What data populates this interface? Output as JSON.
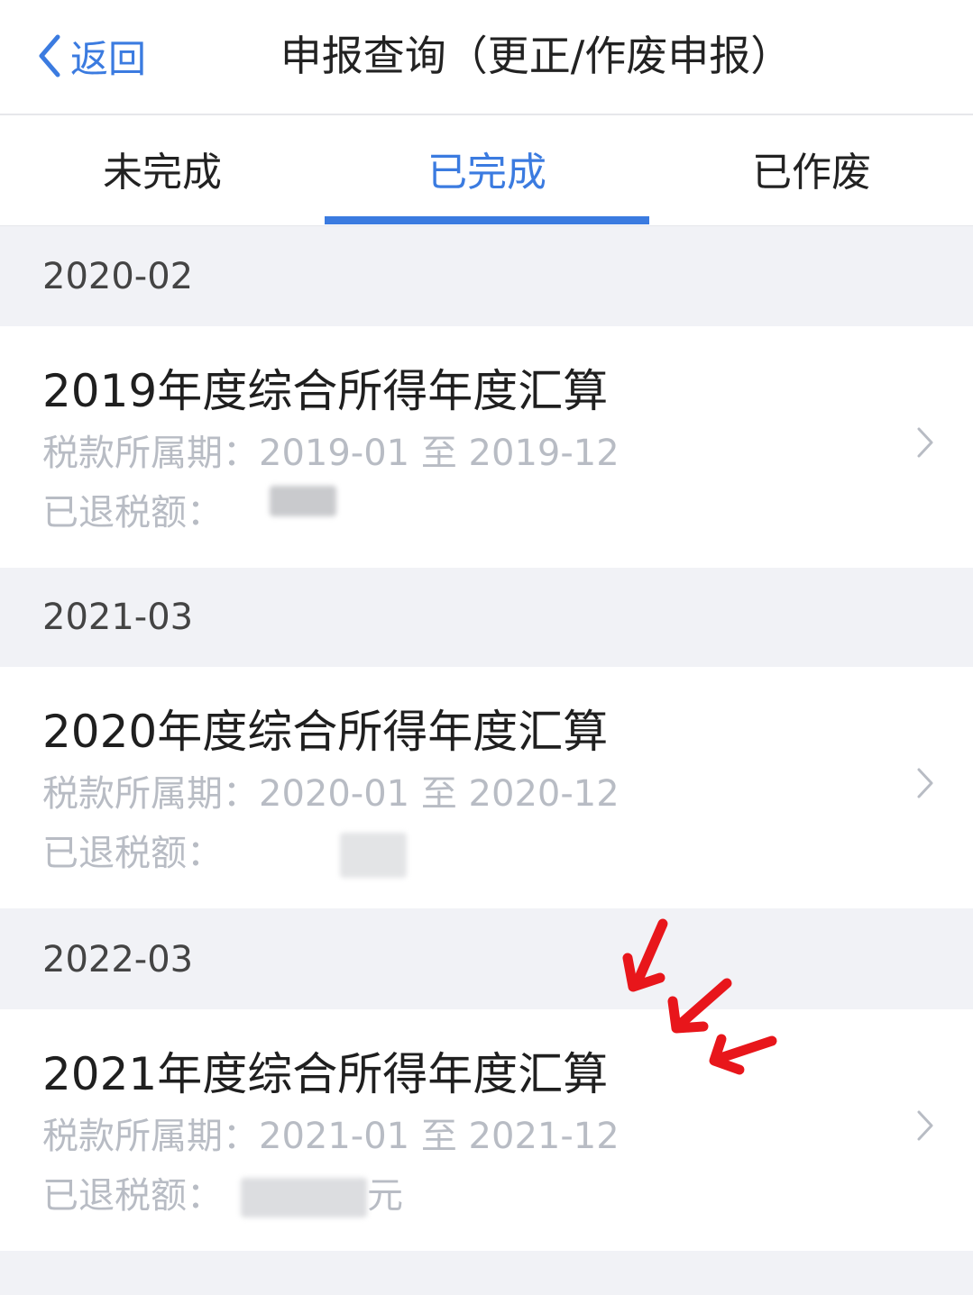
{
  "nav": {
    "back_label": "返回",
    "title": "申报查询（更正/作废申报）"
  },
  "tabs": [
    {
      "label": "未完成",
      "active": false
    },
    {
      "label": "已完成",
      "active": true
    },
    {
      "label": "已作废",
      "active": false
    }
  ],
  "groups": [
    {
      "date": "2020-02",
      "title": "2019年度综合所得年度汇算",
      "period_label": "税款所属期：",
      "period_value": "2019-01 至 2019-12",
      "refund_label": "已退税额：",
      "refund_suffix": ""
    },
    {
      "date": "2021-03",
      "title": "2020年度综合所得年度汇算",
      "period_label": "税款所属期：",
      "period_value": "2020-01 至 2020-12",
      "refund_label": "已退税额：",
      "refund_suffix": ""
    },
    {
      "date": "2022-03",
      "title": "2021年度综合所得年度汇算",
      "period_label": "税款所属期：",
      "period_value": "2021-01 至 2021-12",
      "refund_label": "已退税额：",
      "refund_suffix": "元"
    }
  ],
  "colors": {
    "accent": "#3b7be0",
    "annotation": "#e8161b"
  }
}
